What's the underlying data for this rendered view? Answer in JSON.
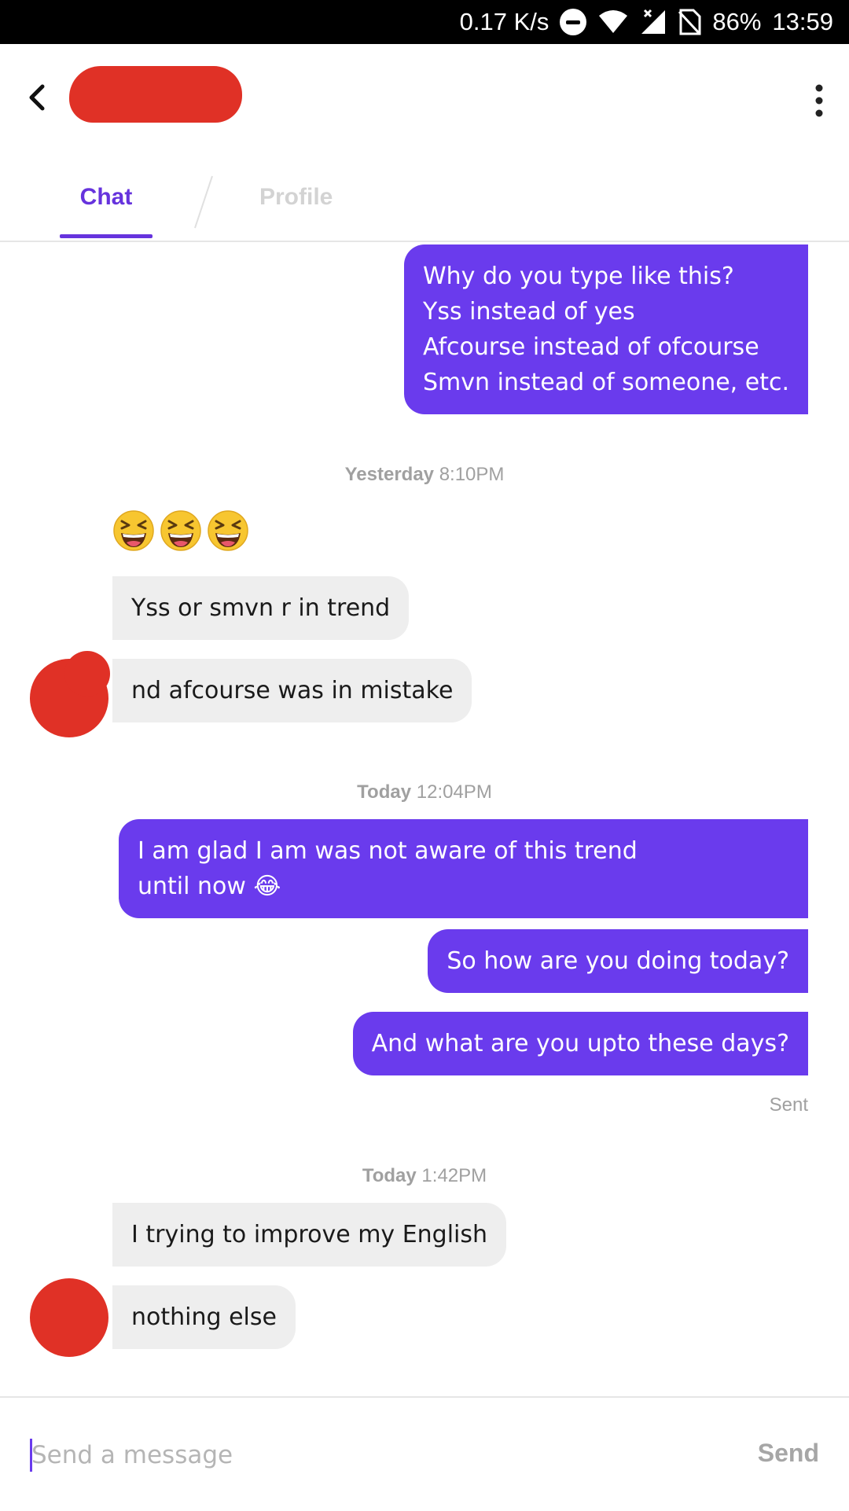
{
  "status_bar": {
    "network_speed": "0.17 K/s",
    "battery": "86%",
    "time": "13:59"
  },
  "header": {
    "tabs": [
      {
        "label": "Chat",
        "active": true
      },
      {
        "label": "Profile",
        "active": false
      }
    ]
  },
  "messages": [
    {
      "direction": "out",
      "text": "Why do you type like this?\nYss instead of yes\nAfcourse instead of ofcourse\nSmvn instead of someone, etc."
    },
    {
      "type": "timestamp",
      "day": "Yesterday",
      "time": "8:10PM"
    },
    {
      "direction": "in",
      "emoji": [
        "grinning-squinting-face",
        "grinning-squinting-face",
        "grinning-squinting-face"
      ]
    },
    {
      "direction": "in",
      "text": "Yss or smvn r in trend"
    },
    {
      "direction": "in",
      "text": "nd afcourse was in mistake"
    },
    {
      "type": "timestamp",
      "day": "Today",
      "time": "12:04PM"
    },
    {
      "direction": "out",
      "text": "I am glad I am was not aware of this trend\nuntil now 😂"
    },
    {
      "direction": "out",
      "text": "So how are you doing today?"
    },
    {
      "direction": "out",
      "text": "And what are you upto these days?"
    },
    {
      "type": "receipt",
      "text": "Sent"
    },
    {
      "type": "timestamp",
      "day": "Today",
      "time": "1:42PM"
    },
    {
      "direction": "in",
      "text": "I trying to improve my English"
    },
    {
      "direction": "in",
      "text": "nothing else"
    }
  ],
  "composer": {
    "placeholder": "Send a message",
    "value": "",
    "send_label": "Send"
  },
  "colors": {
    "accent": "#6633dd",
    "outgoing_bubble": "#6a3bed",
    "incoming_bubble": "#eeeeee",
    "redaction": "#e03126"
  }
}
